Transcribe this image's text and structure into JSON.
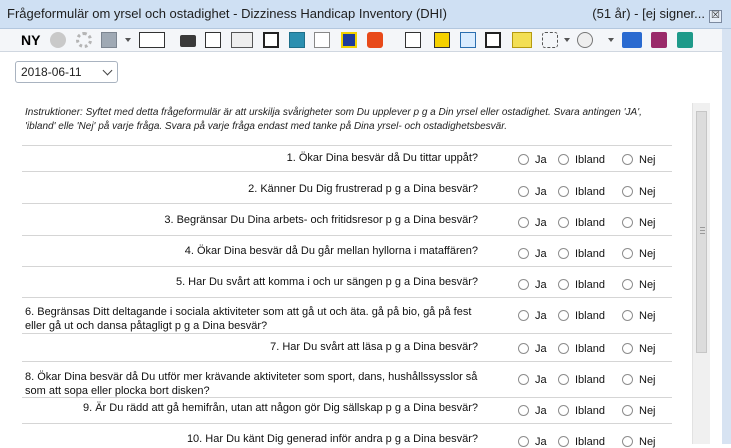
{
  "window": {
    "title": "Frågeformulär om yrsel och ostadighet - Dizziness Handicap Inventory (DHI)",
    "title_right": "(51 år) - [ej signer...",
    "close_label": "☒"
  },
  "toolbar": {
    "new_label": "NY",
    "icons": [
      "cancel-icon",
      "settings-icon",
      "save-icon",
      "journal-icon",
      "briefcase-icon",
      "edit-icon",
      "besok-icon",
      "p-icon",
      "document-icon",
      "calculator-icon",
      "m-icon",
      "flash-icon",
      "checklist-icon",
      "id-icon",
      "card-icon",
      "b-icon",
      "notepad-icon",
      "tools-icon",
      "tools2-icon",
      "app-icon",
      "books-icon",
      "help-icon"
    ]
  },
  "form": {
    "date": "2018-06-11",
    "instructions": "Instruktioner: Syftet med detta frågeformulär är att urskilja svårigheter som Du upplever p g a Din yrsel eller ostadighet. Svara antingen 'JA', 'ibland' elle 'Nej' på varje fråga. Svara på varje fråga endast med tanke på Dina yrsel- och ostadighetsbesvär.",
    "options": [
      "Ja",
      "Ibland",
      "Nej"
    ],
    "questions": [
      "1. Ökar Dina besvär då Du tittar uppåt?",
      "2. Känner Du Dig frustrerad p g a Dina besvär?",
      "3. Begränsar Du Dina arbets- och fritidsresor p g a Dina besvär?",
      "4. Ökar Dina besvär då Du går mellan hyllorna i mataffären?",
      "5. Har Du svårt att komma i och ur sängen p g a Dina besvär?",
      "6. Begränsas Ditt deltagande i sociala aktiviteter som att gå ut och äta. gå på bio, gå på fest eller gå ut och dansa påtagligt p g a Dina besvär?",
      "7. Har Du svårt att läsa p g a Dina besvär?",
      "8. Ökar Dina besvär då Du utför mer krävande aktiviteter som sport, dans, hushållssysslor så som att sopa eller plocka bort disken?",
      "9. Är Du rädd att gå hemifrån, utan att någon gör Dig sällskap p g a Dina besvär?",
      "10. Har Du känt Dig generad inför andra p g a Dina besvär?"
    ]
  }
}
